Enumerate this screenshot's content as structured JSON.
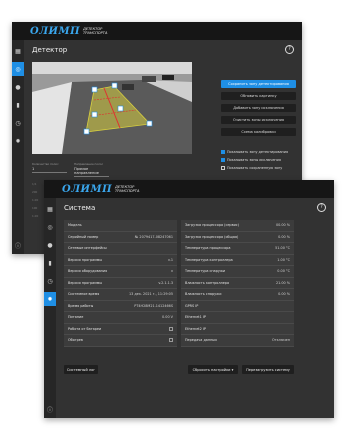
{
  "brand": {
    "logo": "ОЛИМП",
    "sub1": "ДЕТЕКТОР",
    "sub2": "ТРАНСПОРТА"
  },
  "detector": {
    "title": "Детектор",
    "buttons": [
      "Сохранить зону детектирования",
      "Обновить картинку",
      "Добавить зону исключения",
      "Очистить зоны исключения",
      "Схема калибровки"
    ],
    "checks": [
      {
        "label": "Показывать зону детектирования",
        "on": true
      },
      {
        "label": "Показывать зоны исключения",
        "on": true
      },
      {
        "label": "Показывать сохраненную зону",
        "on": false
      }
    ],
    "fields": [
      {
        "label": "Количество полос",
        "value": "1"
      },
      {
        "label": "Направление полос",
        "value": "Прямое направление"
      }
    ],
    "side_values": [
      "1/1",
      "200",
      "1.00",
      "100",
      "1.00"
    ]
  },
  "system": {
    "title": "Система",
    "left_rows": [
      {
        "k": "Модель",
        "v": ""
      },
      {
        "k": "Серийный номер",
        "v": "№ 2079417-08247061"
      },
      {
        "k": "Сетевые интерфейсы",
        "v": ""
      },
      {
        "k": "Версия программы",
        "v": "v.1"
      },
      {
        "k": "Версия оборудования",
        "v": "v"
      },
      {
        "k": "Версия программы",
        "v": "v.2.1.1.3"
      },
      {
        "k": "Системное время",
        "v": "13 дек. 2021 г., 11:29:05"
      },
      {
        "k": "Время работы",
        "v": "PT4H28M21.1412466S"
      },
      {
        "k": "Питание",
        "v": "0.00 V"
      },
      {
        "k": "Работа от батареи",
        "v": "checkbox"
      },
      {
        "k": "Обогрев",
        "v": "checkbox"
      }
    ],
    "right_rows": [
      {
        "k": "Загрузка процессора (сервис)",
        "v": "00.00 %"
      },
      {
        "k": "Загрузка процессора (общая)",
        "v": "0.00 %"
      },
      {
        "k": "Температура процессора",
        "v": "51.00 °C"
      },
      {
        "k": "Температура контроллера",
        "v": "1.00 °C"
      },
      {
        "k": "Температура снаружи",
        "v": "0.00 °C"
      },
      {
        "k": "Влажность контроллера",
        "v": "21.00 %"
      },
      {
        "k": "Влажность снаружи",
        "v": "0.00 %"
      },
      {
        "k": "GPRS IP",
        "v": ""
      },
      {
        "k": "Ethernet1 IP",
        "v": ""
      },
      {
        "k": "Ethernet2 IP",
        "v": ""
      },
      {
        "k": "Передача данных",
        "v": "Отключен"
      }
    ],
    "btn_log": "Системный лог",
    "btn_reset": "Сбросить настройки",
    "btn_reboot": "Перезагрузить систему"
  }
}
